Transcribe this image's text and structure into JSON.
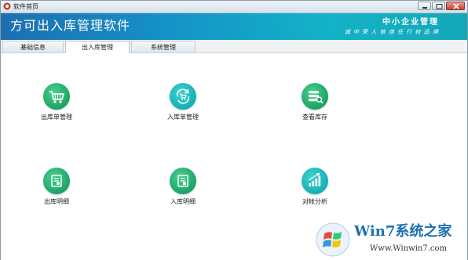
{
  "window": {
    "title": "软件首页"
  },
  "banner": {
    "app_title": "方可出入库管理软件",
    "slogan_main": "中小企业管理",
    "slogan_sub": "诚 中 荣 人 信 信 任 行 较 品 牌"
  },
  "tabs": [
    {
      "label": "基础信息",
      "active": false
    },
    {
      "label": "出入库管理",
      "active": true
    },
    {
      "label": "系统管理",
      "active": false
    }
  ],
  "modules": [
    {
      "label": "出库单管理",
      "icon": "cart-icon",
      "color": "#1ba466"
    },
    {
      "label": "入库单管理",
      "icon": "cart-refresh-icon",
      "color": "#16b0b3"
    },
    {
      "label": "查看库存",
      "icon": "stack-search-icon",
      "color": "#1ba466"
    },
    {
      "label": "出库明细",
      "icon": "document-icon",
      "color": "#1ba466"
    },
    {
      "label": "入库明细",
      "icon": "document-icon",
      "color": "#1ba466"
    },
    {
      "label": "对帐分析",
      "icon": "bar-chart-icon",
      "color": "#16b0b3"
    }
  ],
  "watermark": {
    "brand": "Win7系统之家",
    "url": "Www.Winwin7.com"
  },
  "colors": {
    "banner_start": "#1d6fb0",
    "banner_end": "#14a8b8",
    "green": "#1ba466",
    "teal": "#16b0b3"
  }
}
